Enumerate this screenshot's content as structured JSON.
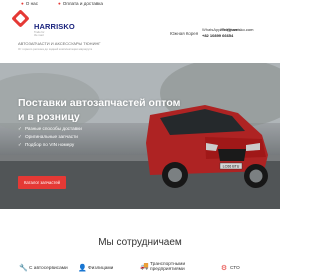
{
  "topnav": {
    "about": "О нас",
    "payment": "Оплата и доставка"
  },
  "header": {
    "logo_text": "HARRISKO",
    "logo_slogan": "Trade for the road",
    "tagline": "АВТОЗАПЧАСТИ И АКСЕССУАРЫ ТЮНИНГ",
    "subtagline": "От горного региона до задней комплектации маршрута",
    "region": "Южная Корея",
    "messengers": "WhatsApp/Telegram",
    "email": "info@harrisko.com",
    "phone": "+82 10899 66654"
  },
  "hero": {
    "title_line1": "Поставки автозапчастей оптом",
    "title_line2": "и в розницу",
    "bullets": [
      "Разные способы доставки",
      "Оригинальные запчасти",
      "Подбор по VIN номеру"
    ],
    "cta": "Каталог запчастей",
    "plate": "LC66 BTU"
  },
  "cooperation": {
    "title": "Мы сотрудничаем",
    "partners": [
      {
        "label": "С автосервисами",
        "icon": "wrench-icon"
      },
      {
        "label": "Физлицами",
        "icon": "person-icon"
      },
      {
        "label": "Транспортными предприятиями",
        "icon": "truck-icon"
      },
      {
        "label": "СТО",
        "icon": "gear-icon"
      }
    ]
  },
  "colors": {
    "accent": "#e53935",
    "brand": "#1a237e",
    "car": "#d32f2f"
  }
}
